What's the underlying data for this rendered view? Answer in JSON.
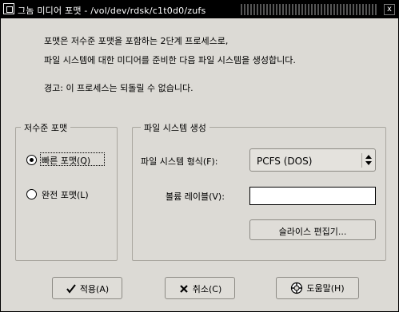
{
  "window": {
    "title": "그놈 미디어 포맷 - /vol/dev/rdsk/c1t0d0/zufs",
    "close_glyph": "x"
  },
  "intro": {
    "line1": "포맷은 저수준 포맷을 포함하는 2단계 프로세스로,",
    "line2": "파일 시스템에 대한 미디어를 준비한 다음 파일 시스템을 생성합니다.",
    "warning": "경고: 이 프로세스는 되돌릴 수 없습니다."
  },
  "low_level_group": {
    "title": "저수준 포맷",
    "options": [
      {
        "label": "빠른 포맷(Q)",
        "checked": true
      },
      {
        "label": "완전 포맷(L)",
        "checked": false
      }
    ]
  },
  "fs_group": {
    "title": "파일 시스템 생성",
    "type_label": "파일 시스템 형식(F):",
    "type_value": "PCFS (DOS)",
    "volume_label": "볼륨 레이블(V):",
    "volume_value": "",
    "slice_editor_button": "슬라이스 편집기..."
  },
  "buttons": {
    "apply": "적용(A)",
    "cancel": "취소(C)",
    "help": "도움말(H)"
  }
}
